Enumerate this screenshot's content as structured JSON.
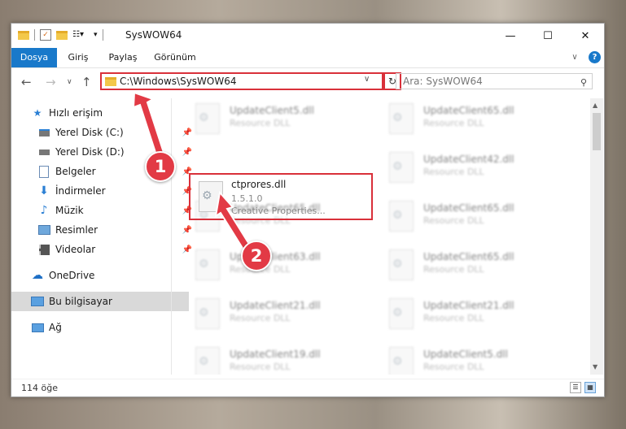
{
  "window": {
    "title": "SysWOW64",
    "minimize": "—",
    "maximize": "☐",
    "close": "✕"
  },
  "ribbon": {
    "tabs": [
      "Dosya",
      "Giriş",
      "Paylaş",
      "Görünüm"
    ],
    "collapse": "∨",
    "help": "?"
  },
  "address": {
    "path": "C:\\Windows\\SysWOW64",
    "search_placeholder": "Ara: SysWOW64"
  },
  "sidebar": {
    "items": [
      {
        "label": "Hızlı erişim",
        "icon": "star-icon"
      },
      {
        "label": "Yerel Disk (C:)",
        "icon": "drive-icon",
        "pinned": true
      },
      {
        "label": "Yerel Disk (D:)",
        "icon": "drive-icon",
        "pinned": true
      },
      {
        "label": "Belgeler",
        "icon": "documents-icon",
        "pinned": true
      },
      {
        "label": "İndirmeler",
        "icon": "download-icon",
        "pinned": true
      },
      {
        "label": "Müzik",
        "icon": "music-icon",
        "pinned": true
      },
      {
        "label": "Resimler",
        "icon": "pictures-icon",
        "pinned": true
      },
      {
        "label": "Videolar",
        "icon": "videos-icon",
        "pinned": true
      },
      {
        "label": "OneDrive",
        "icon": "onedrive-icon"
      },
      {
        "label": "Bu bilgisayar",
        "icon": "computer-icon",
        "selected": true
      },
      {
        "label": "Ağ",
        "icon": "network-icon"
      }
    ]
  },
  "files": {
    "left": [
      {
        "name": "UpdateClient5.dll",
        "desc": "Resource DLL"
      },
      {
        "name": "UpdateClient65.dll",
        "desc": "Resource DLL"
      },
      {
        "name": "UpdateClient63.dll",
        "desc": "Resource DLL"
      },
      {
        "name": "UpdateClient21.dll",
        "desc": "Resource DLL"
      },
      {
        "name": "UpdateClient19.dll",
        "desc": "Resource DLL"
      }
    ],
    "right": [
      {
        "name": "UpdateClient65.dll",
        "desc": "Resource DLL"
      },
      {
        "name": "UpdateClient42.dll",
        "desc": "Resource DLL"
      },
      {
        "name": "UpdateClient65.dll",
        "desc": "Resource DLL"
      },
      {
        "name": "UpdateClient65.dll",
        "desc": "Resource DLL"
      },
      {
        "name": "UpdateClient21.dll",
        "desc": "Resource DLL"
      },
      {
        "name": "UpdateClient5.dll",
        "desc": "Resource DLL"
      }
    ],
    "highlighted": {
      "name": "ctprores.dll",
      "version": "1.5.1.0",
      "description": "Creative Properties..."
    }
  },
  "status": {
    "count": "114 öğe"
  },
  "annotations": {
    "badge1": "1",
    "badge2": "2",
    "color": "#e23a45"
  }
}
